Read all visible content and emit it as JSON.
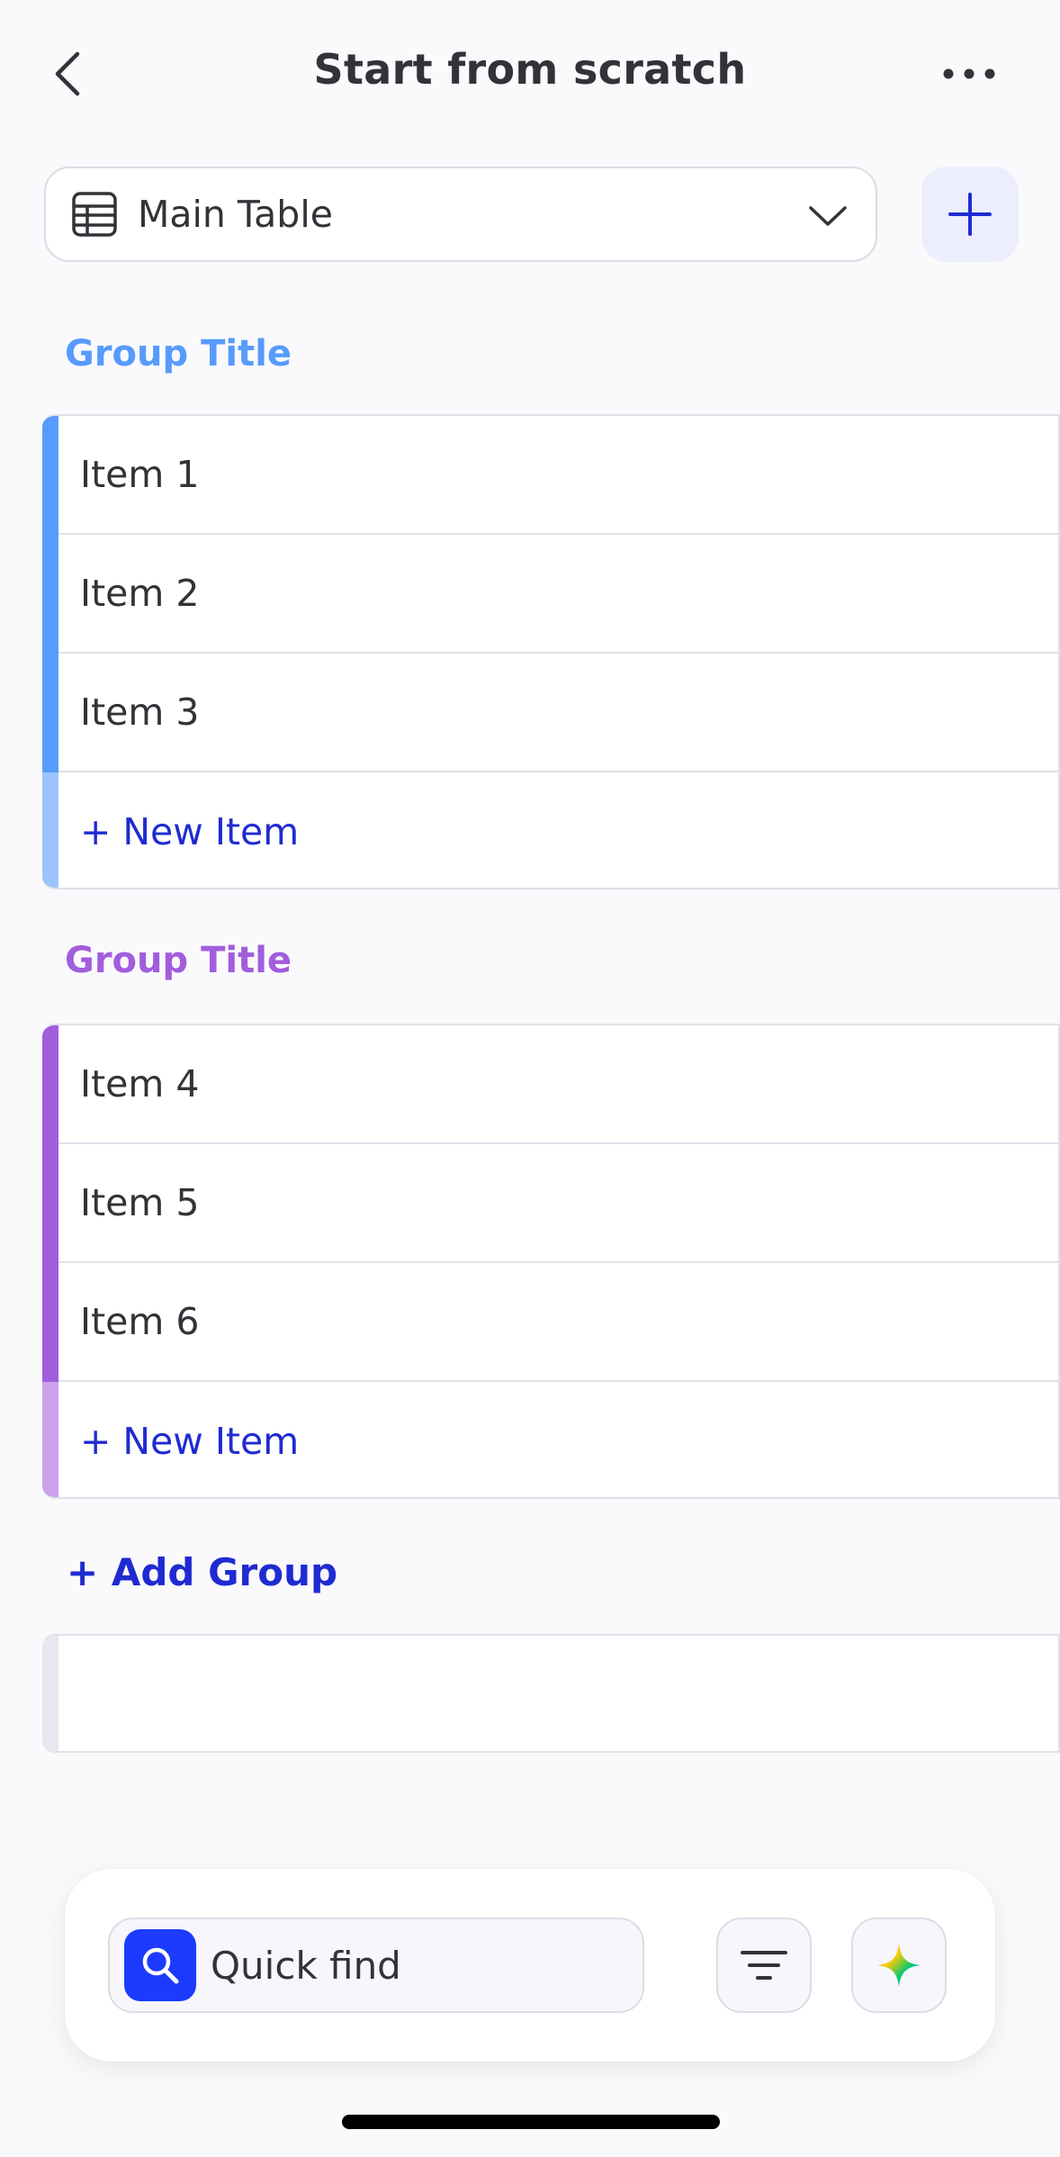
{
  "header": {
    "title": "Start from scratch",
    "back_icon": "chevron-left-icon",
    "more_icon": "more-horizontal-icon"
  },
  "board_selector": {
    "label": "Main Table",
    "icon": "table-icon"
  },
  "groups": [
    {
      "title": "Group Title",
      "color": "#579bfc",
      "light_color": "#9cc3fd",
      "items": [
        "Item 1",
        "Item 2",
        "Item 3"
      ],
      "new_item_label": "+ New Item"
    },
    {
      "title": "Group Title",
      "color": "#a25ddc",
      "light_color": "#cba0ec",
      "items": [
        "Item 4",
        "Item 5",
        "Item 6"
      ],
      "new_item_label": "+ New Item"
    }
  ],
  "add_group_label": "+ Add Group",
  "toolbar": {
    "search_placeholder": "Quick find",
    "filter_icon": "filter-icon",
    "ai_icon": "sparkle-icon"
  },
  "colors": {
    "accent": "#1f2bd1",
    "search_accent": "#1c3bff"
  }
}
